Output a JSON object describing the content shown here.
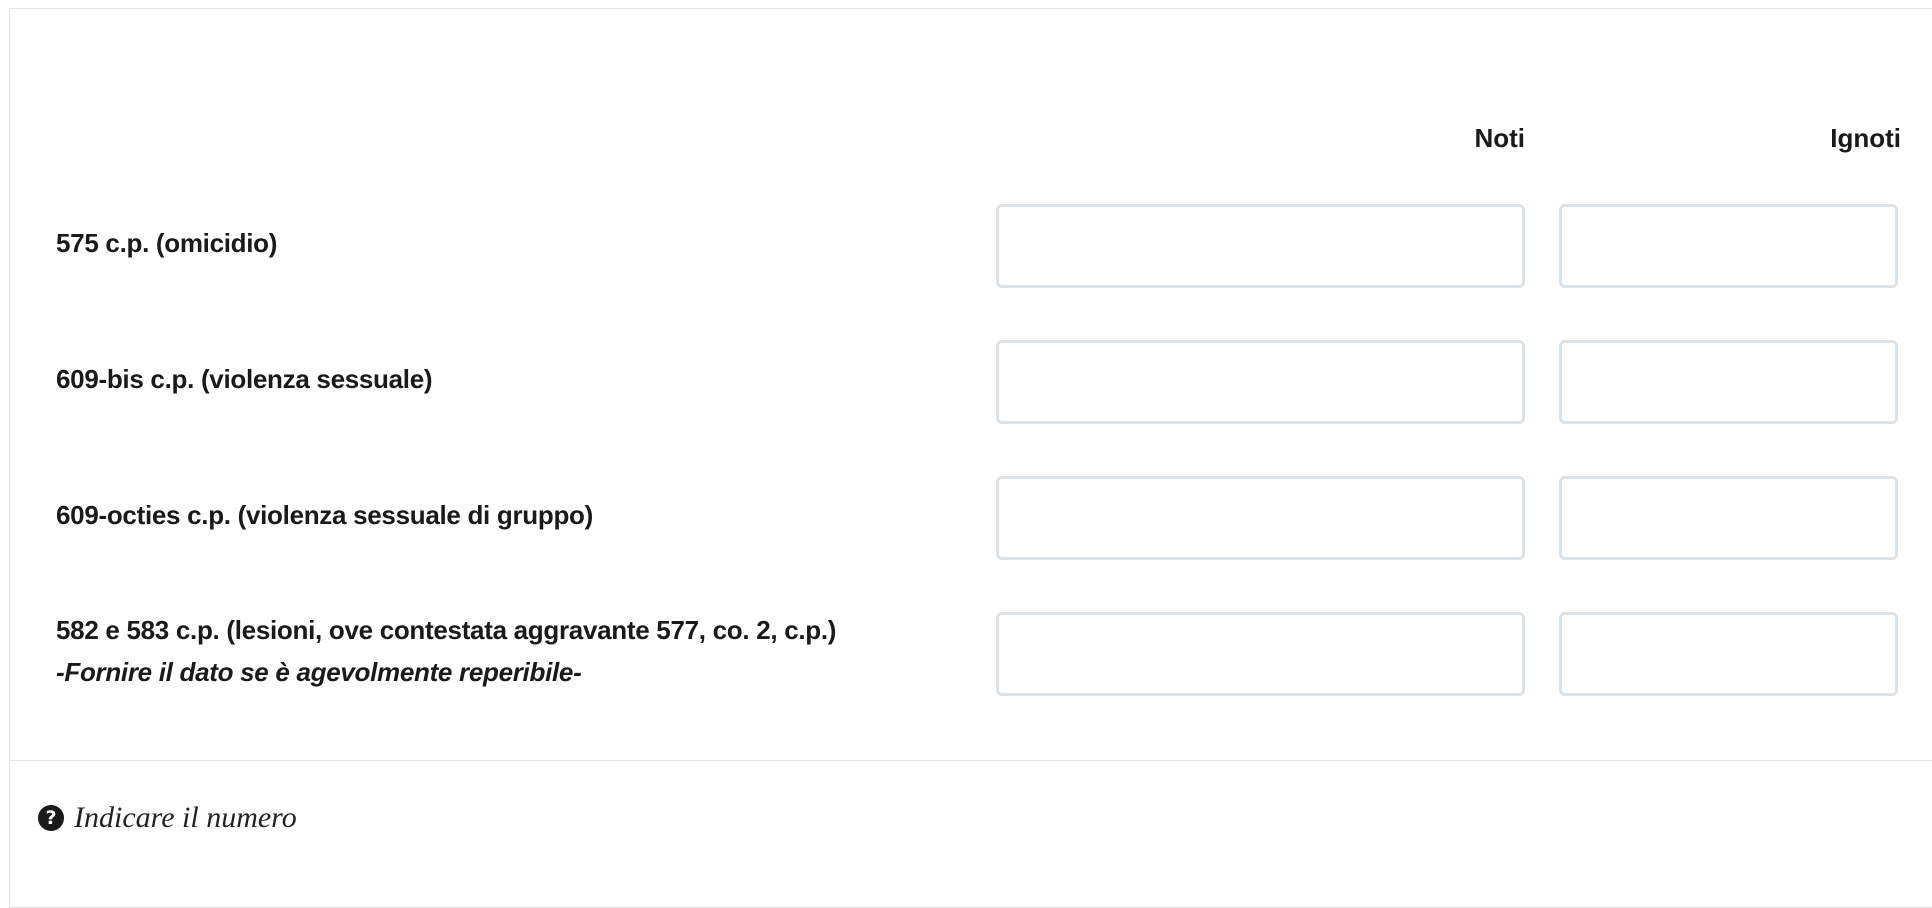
{
  "columns": {
    "noti": "Noti",
    "ignoti": "Ignoti"
  },
  "rows": [
    {
      "label": "575 c.p. (omicidio)",
      "note": "",
      "noti_value": "",
      "ignoti_value": ""
    },
    {
      "label": "609-bis c.p. (violenza sessuale)",
      "note": "",
      "noti_value": "",
      "ignoti_value": ""
    },
    {
      "label": "609-octies c.p. (violenza sessuale di gruppo)",
      "note": "",
      "noti_value": "",
      "ignoti_value": ""
    },
    {
      "label": "582 e 583 c.p. (lesioni, ove contestata aggravante 577, co. 2, c.p.)",
      "note": "-Fornire il dato se è agevolmente reperibile-",
      "noti_value": "",
      "ignoti_value": ""
    }
  ],
  "footer": {
    "icon": "question-circle-icon",
    "hint": "Indicare il numero"
  },
  "colors": {
    "field_border": "#dbe3ea",
    "panel_border": "#e3e3e3",
    "text": "#1a1a1a"
  }
}
